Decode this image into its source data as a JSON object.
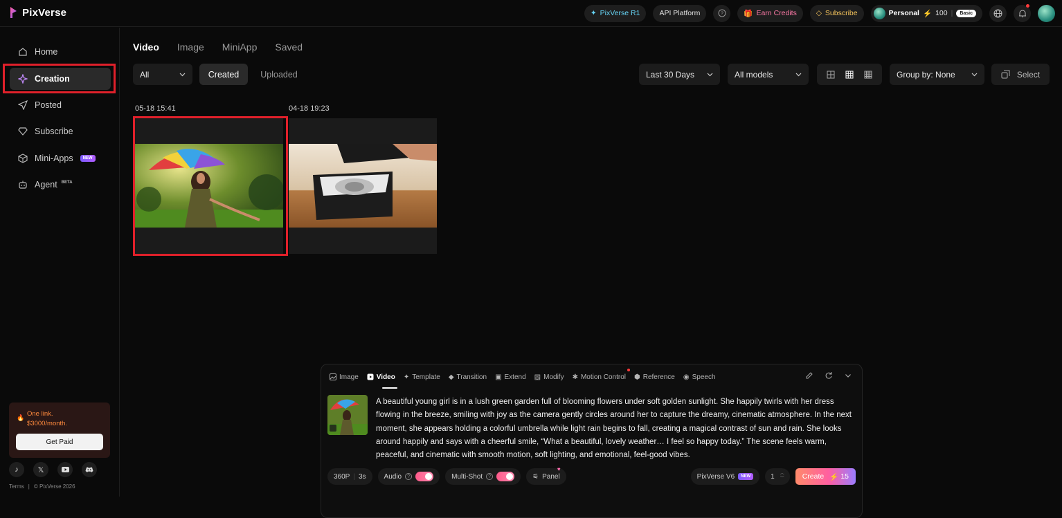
{
  "app": {
    "name": "PixVerse"
  },
  "topnav": {
    "r1": "PixVerse R1",
    "api": "API Platform",
    "earn": "Earn Credits",
    "subscribe": "Subscribe",
    "account": "Personal",
    "credits": "100",
    "plan": "Basic"
  },
  "sidebar": {
    "items": [
      {
        "label": "Home",
        "icon": "home-icon"
      },
      {
        "label": "Creation",
        "icon": "sparkle-icon"
      },
      {
        "label": "Posted",
        "icon": "send-icon"
      },
      {
        "label": "Subscribe",
        "icon": "diamond-icon"
      },
      {
        "label": "Mini-Apps",
        "icon": "cube-icon",
        "tag": "NEW"
      },
      {
        "label": "Agent",
        "icon": "robot-icon",
        "tag": "BETA"
      }
    ],
    "promo": {
      "line1": "One link.",
      "line2": "$3000/month.",
      "button": "Get Paid"
    },
    "footer": {
      "terms": "Terms",
      "separator": "|",
      "copyright": "© PixVerse 2026"
    }
  },
  "main": {
    "tabs": [
      "Video",
      "Image",
      "MiniApp",
      "Saved"
    ],
    "filter": "All",
    "created": "Created",
    "uploaded": "Uploaded",
    "date_range": "Last 30 Days",
    "models": "All models",
    "group_by": "Group by: None",
    "select": "Select",
    "items": [
      {
        "date": "05-18 15:41"
      },
      {
        "date": "04-18 19:23"
      }
    ]
  },
  "composer": {
    "tabs": [
      "Image",
      "Video",
      "Template",
      "Transition",
      "Extend",
      "Modify",
      "Motion Control",
      "Reference",
      "Speech"
    ],
    "prompt": "A beautiful young girl is in a lush green garden full of blooming flowers under soft golden sunlight. She happily twirls with her dress flowing in the breeze, smiling with joy as the camera gently circles around her to capture the dreamy, cinematic atmosphere. In the next moment, she appears holding a colorful umbrella while light rain begins to fall, creating a magical contrast of sun and rain. She looks around happily and says with a cheerful smile, “What a beautiful, lovely weather… I feel so happy today.” The scene feels warm, peaceful, and cinematic with smooth motion, soft lighting, and emotional, feel-good vibes.",
    "resolution": "360P",
    "duration": "3s",
    "audio": "Audio",
    "multishot": "Multi-Shot",
    "panel": "Panel",
    "model": "PixVerse V6",
    "model_tag": "NEW",
    "count": "1",
    "create": "Create",
    "cost": "15"
  },
  "colors": {
    "accent": "#ff5fa0",
    "highlight": "#e0202a"
  }
}
